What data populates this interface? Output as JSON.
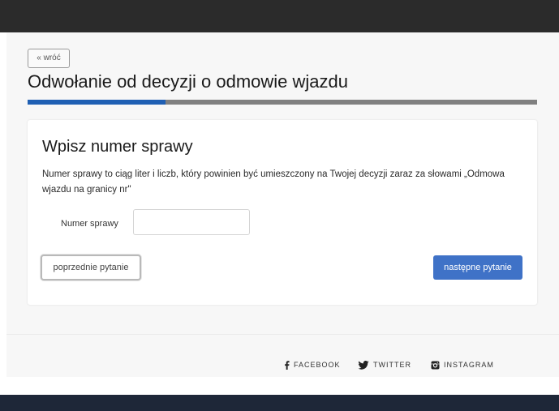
{
  "nav": {
    "back_label": "« wróć"
  },
  "header": {
    "title": "Odwołanie od decyzji o odmowie wjazdu"
  },
  "progress": {
    "fraction": 0.27,
    "fill_color": "#1f5fb3",
    "track_color": "#808080"
  },
  "form": {
    "title": "Wpisz numer sprawy",
    "description": "Numer sprawy to ciąg liter i liczb, który powinien być umieszczony na Twojej decyzji zaraz za słowami „Odmowa wjazdu na granicy nr\"",
    "case_number_label": "Numer sprawy",
    "case_number_value": "",
    "prev_button": "poprzednie pytanie",
    "next_button": "następne pytanie"
  },
  "footer": {
    "social": [
      {
        "label": "FACEBOOK",
        "icon": "facebook-icon"
      },
      {
        "label": "TWITTER",
        "icon": "twitter-icon"
      },
      {
        "label": "INSTAGRAM",
        "icon": "instagram-icon"
      }
    ]
  },
  "colors": {
    "accent": "#3f72c7",
    "top_bar": "#2b2b2b",
    "bottom_bar": "#1e2738"
  }
}
